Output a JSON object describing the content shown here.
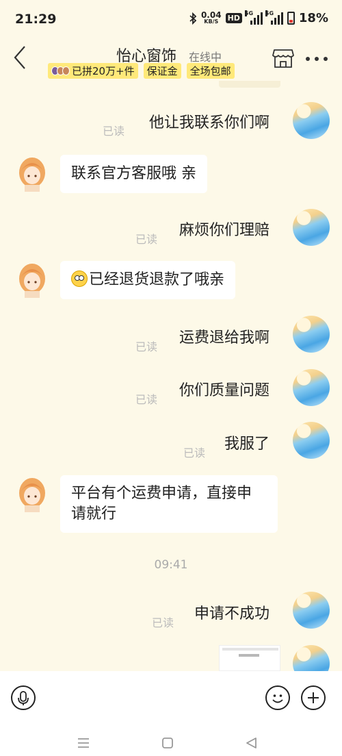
{
  "status": {
    "time": "21:29",
    "net_speed": "0.04",
    "net_unit": "KB/S",
    "hd": "HD",
    "sim1": "5G",
    "sim2": "5G",
    "battery": "18%"
  },
  "header": {
    "shop_name": "怡心窗饰",
    "online": "在线中",
    "badges": [
      "已拼20万+件",
      "保证金",
      "全场包邮"
    ]
  },
  "messages": [
    {
      "side": "right",
      "text": "他让我联系你们啊",
      "read": "已读"
    },
    {
      "side": "left",
      "text": "联系官方客服哦  亲"
    },
    {
      "side": "right",
      "text": "麻烦你们理赔",
      "read": "已读"
    },
    {
      "side": "left",
      "text": "已经退货退款了哦亲",
      "emoji": "face-emoji"
    },
    {
      "side": "right",
      "text": "运费退给我啊",
      "read": "已读"
    },
    {
      "side": "right",
      "text": "你们质量问题",
      "read": "已读"
    },
    {
      "side": "right",
      "text": "我服了",
      "read": "已读"
    },
    {
      "side": "left",
      "text_lines": [
        "平台有个运费申请，直接申",
        "请就行"
      ]
    },
    {
      "side": "right",
      "text": "申请不成功",
      "read": "已读"
    }
  ],
  "timestamp": "09:41",
  "icons": {
    "back": "back-arrow-icon",
    "store": "store-icon",
    "more": "more-icon",
    "voice": "microphone-icon",
    "emoji": "smiley-icon",
    "add": "plus-icon"
  },
  "colors": {
    "background": "#fdf9e8",
    "badge": "#ffe97a",
    "read_text": "#bbbbbb"
  }
}
